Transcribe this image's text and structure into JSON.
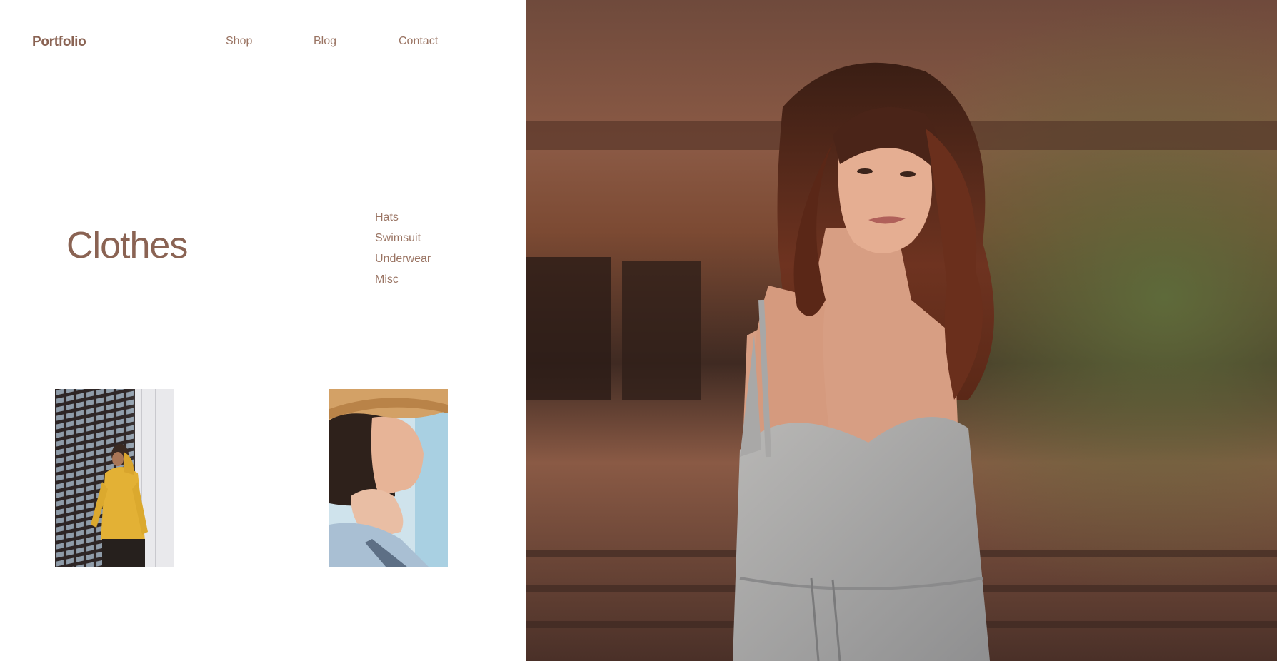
{
  "header": {
    "logo": "Portfolio",
    "nav": [
      "Shop",
      "Blog",
      "Contact"
    ]
  },
  "hero": {
    "title": "Clothes"
  },
  "categories": [
    "Hats",
    "Swimsuit",
    "Underwear",
    "Misc"
  ],
  "gallery": [
    {
      "subject": "man-yellow-hoodie-photo"
    },
    {
      "subject": "woman-straw-hat-photo"
    }
  ],
  "feature_photo": {
    "subject": "woman-grey-dress-photo"
  },
  "colors": {
    "accent": "#8a6353",
    "nav_text": "#9a7463",
    "background": "#ffffff"
  }
}
